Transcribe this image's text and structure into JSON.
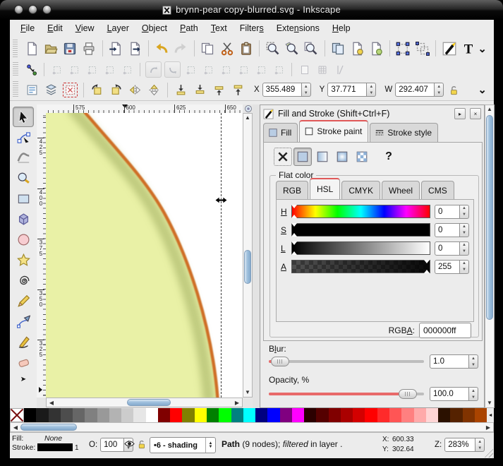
{
  "window": {
    "title": "brynn-pear copy-blurred.svg - Inkscape",
    "traffic_lights": [
      "close-button",
      "minimize-button",
      "zoom-button"
    ]
  },
  "menu": {
    "items": [
      {
        "pre": "",
        "mn": "F",
        "post": "ile"
      },
      {
        "pre": "",
        "mn": "E",
        "post": "dit"
      },
      {
        "pre": "",
        "mn": "V",
        "post": "iew"
      },
      {
        "pre": "",
        "mn": "L",
        "post": "ayer"
      },
      {
        "pre": "",
        "mn": "O",
        "post": "bject"
      },
      {
        "pre": "",
        "mn": "P",
        "post": "ath"
      },
      {
        "pre": "",
        "mn": "T",
        "post": "ext"
      },
      {
        "pre": "Filter",
        "mn": "s",
        "post": ""
      },
      {
        "pre": "Exte",
        "mn": "n",
        "post": "sions"
      },
      {
        "pre": "",
        "mn": "H",
        "post": "elp"
      }
    ]
  },
  "toolbars": {
    "commands": [
      {
        "icon": "new-document"
      },
      {
        "icon": "open-document"
      },
      {
        "icon": "save-document"
      },
      {
        "icon": "print"
      },
      {
        "sep": true
      },
      {
        "icon": "import"
      },
      {
        "icon": "export"
      },
      {
        "sep": true
      },
      {
        "icon": "undo"
      },
      {
        "icon": "redo",
        "dim": true
      },
      {
        "sep": true
      },
      {
        "icon": "copy"
      },
      {
        "icon": "cut"
      },
      {
        "icon": "paste"
      },
      {
        "sep": true
      },
      {
        "icon": "zoom-selection"
      },
      {
        "icon": "zoom-drawing"
      },
      {
        "icon": "zoom-page"
      },
      {
        "sep": true
      },
      {
        "icon": "duplicate"
      },
      {
        "icon": "create-clone"
      },
      {
        "icon": "unlink-clone"
      },
      {
        "sep": true
      },
      {
        "icon": "group"
      },
      {
        "icon": "ungroup"
      },
      {
        "sep": true
      },
      {
        "icon": "fill-stroke-dialog"
      },
      {
        "icon": "text-dialog"
      }
    ],
    "snap": [
      {
        "icon": "snap-master"
      },
      {
        "sep": true
      },
      {
        "icon": "snap-bbox",
        "dim": true
      },
      {
        "icon": "snap-bbox-edges",
        "dim": true
      },
      {
        "icon": "snap-bbox-corners",
        "dim": true
      },
      {
        "icon": "snap-bbox-edge-midpoints",
        "dim": true
      },
      {
        "icon": "snap-bbox-centers",
        "dim": true
      },
      {
        "sep": true
      },
      {
        "icon": "snap-nodes",
        "dim": true,
        "framed": true
      },
      {
        "icon": "snap-paths",
        "dim": true,
        "framed": true
      },
      {
        "icon": "snap-path-intersections",
        "dim": true
      },
      {
        "icon": "snap-cusp-nodes",
        "dim": true
      },
      {
        "icon": "snap-smooth-nodes",
        "dim": true
      },
      {
        "icon": "snap-midpoints",
        "dim": true
      },
      {
        "icon": "snap-object-centers",
        "dim": true
      },
      {
        "icon": "snap-rotation-centers",
        "dim": true
      },
      {
        "sep": true
      },
      {
        "icon": "snap-page-border",
        "dim": true
      },
      {
        "icon": "snap-grid",
        "dim": true
      },
      {
        "icon": "snap-guides",
        "dim": true
      }
    ],
    "toolctrl": [
      {
        "icon": "select-all"
      },
      {
        "icon": "select-all-layers"
      },
      {
        "icon": "deselect",
        "hl": true
      },
      {
        "sep": true
      },
      {
        "icon": "rotate-ccw"
      },
      {
        "icon": "rotate-cw"
      },
      {
        "icon": "flip-horizontal"
      },
      {
        "icon": "flip-vertical"
      },
      {
        "sep": true
      },
      {
        "icon": "lower-to-bottom"
      },
      {
        "icon": "lower"
      },
      {
        "icon": "raise"
      },
      {
        "icon": "raise-to-top"
      }
    ],
    "toolctrl_fields": [
      {
        "label": "X",
        "value": "355.489"
      },
      {
        "label": "Y",
        "value": "37.771"
      },
      {
        "label": "W",
        "value": "292.407"
      }
    ]
  },
  "toolbox": {
    "tools": [
      {
        "icon": "selector-tool",
        "pressed": true
      },
      {
        "icon": "node-tool"
      },
      {
        "icon": "tweak-tool"
      },
      {
        "icon": "zoom-tool"
      },
      {
        "icon": "rectangle-tool"
      },
      {
        "icon": "box3d-tool"
      },
      {
        "icon": "ellipse-tool"
      },
      {
        "icon": "star-tool"
      },
      {
        "icon": "spiral-tool"
      },
      {
        "icon": "pencil-tool"
      },
      {
        "icon": "pen-tool"
      },
      {
        "icon": "calligraphy-tool"
      },
      {
        "icon": "eraser-tool"
      }
    ],
    "expander": "➤"
  },
  "rulers": {
    "horizontal": [
      "575",
      "600",
      "625",
      "650"
    ],
    "vertical": [
      "425",
      "400",
      "375",
      "350",
      "325"
    ]
  },
  "canvas": {
    "artwork_fill": "#e9f1a6",
    "artwork_shade": "#b4c073",
    "artwork_stroke": "#cf6e27"
  },
  "panel": {
    "title": "Fill and Stroke (Shift+Ctrl+F)",
    "detach_button": "▸",
    "close_button": "×",
    "tabs": [
      {
        "label": "Fill",
        "icon": "fill-tab",
        "sel": false
      },
      {
        "label": "Stroke paint",
        "icon": "stroke-paint-tab",
        "sel": true
      },
      {
        "label": "Stroke style",
        "icon": "stroke-style-tab",
        "sel": false
      }
    ],
    "paint_modes": [
      {
        "icon": "no-paint",
        "style": "dotted"
      },
      {
        "icon": "flat-color",
        "style": "pressed"
      },
      {
        "icon": "linear-gradient"
      },
      {
        "icon": "radial-gradient"
      },
      {
        "icon": "pattern"
      },
      {
        "icon": "unknown-paint",
        "glyph": "?",
        "style": "q"
      }
    ],
    "frame_label": "Flat color",
    "color_tabs": [
      {
        "label": "RGB",
        "sel": false
      },
      {
        "label": "HSL",
        "sel": true
      },
      {
        "label": "CMYK",
        "sel": false
      },
      {
        "label": "Wheel",
        "sel": false
      },
      {
        "label": "CMS",
        "sel": false
      }
    ],
    "sliders": [
      {
        "label": "H",
        "value": "0",
        "kind": "hue",
        "pos": 0
      },
      {
        "label": "S",
        "value": "0",
        "kind": "sat",
        "pos": 0
      },
      {
        "label": "L",
        "value": "0",
        "kind": "lig",
        "pos": 0
      },
      {
        "label": "A",
        "value": "255",
        "kind": "alp",
        "pos": 100
      }
    ],
    "rgba": {
      "pre": "RGB",
      "mn": "A",
      "post": ":",
      "value": "000000ff"
    },
    "blur": {
      "pre": "B",
      "mn": "l",
      "post": "ur:",
      "value": "1.0",
      "pos": 4
    },
    "opacity": {
      "label": "Opacity, %",
      "value": "100.0",
      "pos": 88
    }
  },
  "palette": {
    "colors": [
      "#000000",
      "#1a1a1a",
      "#333333",
      "#4d4d4d",
      "#666666",
      "#808080",
      "#999999",
      "#b3b3b3",
      "#cccccc",
      "#e6e6e6",
      "#ffffff",
      "#800000",
      "#ff0000",
      "#808000",
      "#ffff00",
      "#008000",
      "#00ff00",
      "#008080",
      "#00ffff",
      "#000080",
      "#0000ff",
      "#800080",
      "#ff00ff",
      "#2b0000",
      "#550000",
      "#800000",
      "#aa0000",
      "#d40000",
      "#ff0000",
      "#ff2a2a",
      "#ff5555",
      "#ff8080",
      "#ffaaaa",
      "#ffd5d5",
      "#2b1100",
      "#552200",
      "#803300",
      "#aa4400"
    ],
    "overflow_arrow": "◄"
  },
  "statusbar": {
    "fill_label": "Fill:",
    "fill_value": "None",
    "stroke_label": "Stroke:",
    "stroke_width": "1",
    "opacity_label": "O:",
    "opacity_value": "100",
    "layer_value": "•6 - shading",
    "message": {
      "bold": "Path",
      "mid": " (9 nodes); ",
      "italic": "filtered",
      "tail": " in layer ."
    },
    "x_label": "X:",
    "x_value": "600.33",
    "y_label": "Y:",
    "y_value": "302.64",
    "z_label": "Z:",
    "z_value": "283%"
  }
}
